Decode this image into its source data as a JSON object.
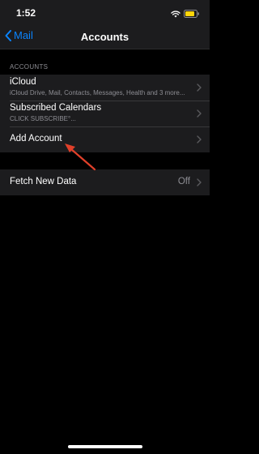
{
  "status": {
    "time": "1:52",
    "icons": [
      "wifi-icon",
      "battery-icon"
    ]
  },
  "nav": {
    "back_label": "Mail",
    "title": "Accounts"
  },
  "accounts_section": {
    "header": "ACCOUNTS",
    "items": [
      {
        "title": "iCloud",
        "subtitle": "iCloud Drive, Mail, Contacts, Messages, Health and 3 more..."
      },
      {
        "title": "Subscribed Calendars",
        "subtitle": "CLICK SUBSCRIBE°..."
      },
      {
        "title": "Add Account",
        "subtitle": ""
      }
    ]
  },
  "fetch": {
    "title": "Fetch New Data",
    "value": "Off"
  },
  "colors": {
    "accent": "#0a84ff",
    "background": "#000000",
    "cell": "#1c1c1e",
    "annotation": "#e0402a"
  }
}
